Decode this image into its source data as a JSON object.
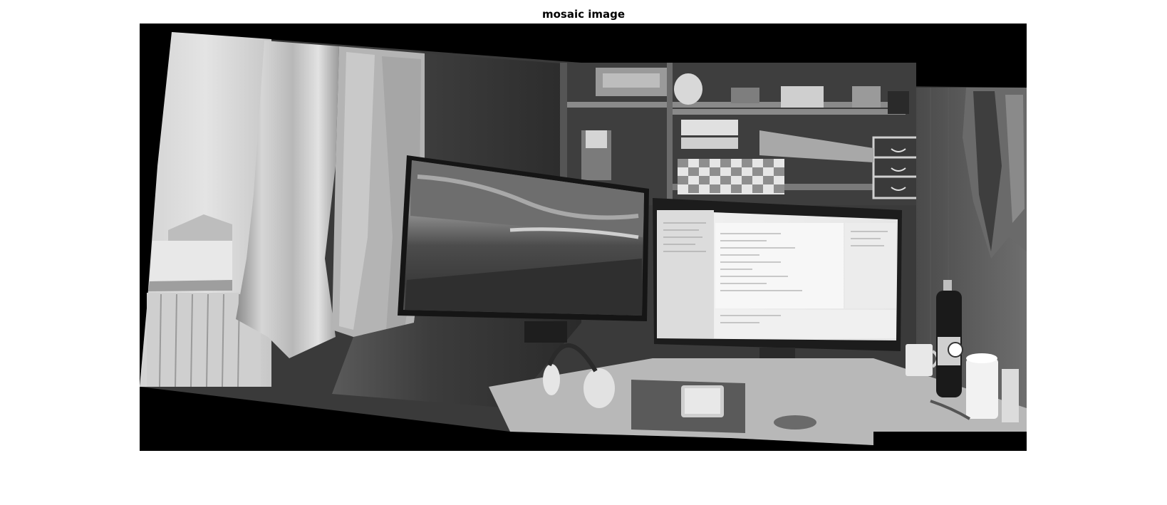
{
  "figure": {
    "title": "mosaic image"
  },
  "colors": {
    "background": "#ffffff",
    "canvas": "#000000"
  }
}
